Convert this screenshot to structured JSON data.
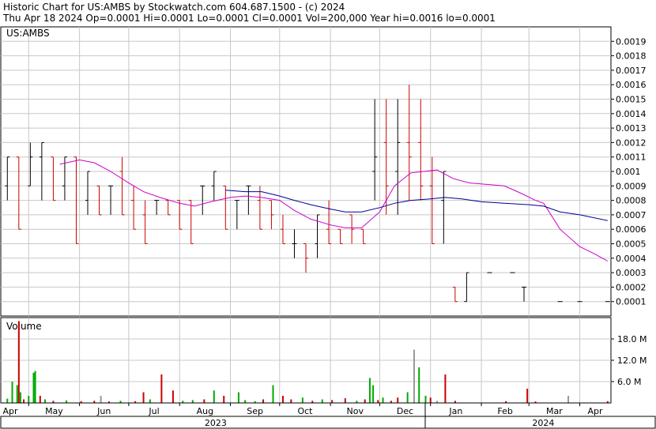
{
  "header": {
    "line1": "Historic Chart for US:AMBS by Stockwatch.com 604.687.1500 - (c) 2024",
    "line2": "Thu Apr 18 2024   Op=0.0001   Hi=0.0001   Lo=0.0001   Cl=0.0001   Vol=200,000   Year hi=0.0016   lo=0.0001"
  },
  "price_panel": {
    "label": "US:AMBS"
  },
  "volume_panel": {
    "label": "Volume"
  },
  "colors": {
    "up": "#000000",
    "down": "#cc0000",
    "ma_short": "#cc00cc",
    "ma_long": "#000099",
    "grid": "#c8c8c8",
    "vol_up": "#00aa00",
    "vol_down": "#cc0000",
    "vol_flat": "#999999"
  },
  "chart_data": [
    {
      "type": "line",
      "yticks": [
        "0.0001",
        "0.0002",
        "0.0003",
        "0.0004",
        "0.0005",
        "0.0006",
        "0.0007",
        "0.0008",
        "0.0009",
        "0.001",
        "0.0011",
        "0.0012",
        "0.0013",
        "0.0014",
        "0.0015",
        "0.0016",
        "0.0017",
        "0.0018",
        "0.0019"
      ],
      "ylim": [
        0,
        0.002
      ],
      "months": [
        "Apr",
        "May",
        "Jun",
        "Jul",
        "Aug",
        "Sep",
        "Oct",
        "Nov",
        "Dec",
        "Jan",
        "Feb",
        "Mar",
        "Apr"
      ],
      "years": [
        "2023",
        "2024"
      ],
      "ohlc": [
        [
          "2023-04-18",
          0.0009,
          0.0011,
          0.0008,
          0.0011
        ],
        [
          "2023-04-25",
          0.0011,
          0.0011,
          0.0006,
          0.0006
        ],
        [
          "2023-05-02",
          0.0009,
          0.0012,
          0.0009,
          0.0011
        ],
        [
          "2023-05-09",
          0.0011,
          0.0012,
          0.0008,
          0.0012
        ],
        [
          "2023-05-16",
          0.0011,
          0.0011,
          0.0008,
          0.0008
        ],
        [
          "2023-05-23",
          0.0009,
          0.0011,
          0.0008,
          0.0011
        ],
        [
          "2023-05-30",
          0.0011,
          0.0011,
          0.0005,
          0.0005
        ],
        [
          "2023-06-06",
          0.0008,
          0.001,
          0.0007,
          0.001
        ],
        [
          "2023-06-13",
          0.0009,
          0.0009,
          0.0007,
          0.0007
        ],
        [
          "2023-06-20",
          0.0009,
          0.0009,
          0.0007,
          0.0009
        ],
        [
          "2023-06-27",
          0.001,
          0.0011,
          0.0007,
          0.0007
        ],
        [
          "2023-07-04",
          0.0008,
          0.0009,
          0.0006,
          0.0006
        ],
        [
          "2023-07-11",
          0.0007,
          0.0008,
          0.0005,
          0.0005
        ],
        [
          "2023-07-18",
          0.0008,
          0.0008,
          0.0007,
          0.0008
        ],
        [
          "2023-07-25",
          0.0008,
          0.0008,
          0.0007,
          0.0007
        ],
        [
          "2023-08-01",
          0.0008,
          0.0008,
          0.0006,
          0.0006
        ],
        [
          "2023-08-08",
          0.0008,
          0.0008,
          0.0005,
          0.0005
        ],
        [
          "2023-08-15",
          0.0009,
          0.0009,
          0.0007,
          0.0009
        ],
        [
          "2023-08-22",
          0.0009,
          0.001,
          0.0008,
          0.001
        ],
        [
          "2023-08-29",
          0.0009,
          0.0009,
          0.0006,
          0.0006
        ],
        [
          "2023-09-05",
          0.0008,
          0.0008,
          0.0006,
          0.0008
        ],
        [
          "2023-09-12",
          0.0009,
          0.0009,
          0.0007,
          0.0009
        ],
        [
          "2023-09-19",
          0.0008,
          0.0009,
          0.0006,
          0.0006
        ],
        [
          "2023-09-26",
          0.0008,
          0.0008,
          0.0006,
          0.0007
        ],
        [
          "2023-10-03",
          0.0006,
          0.0007,
          0.0005,
          0.0005
        ],
        [
          "2023-10-10",
          0.0005,
          0.0006,
          0.0004,
          0.0005
        ],
        [
          "2023-10-17",
          0.0005,
          0.0005,
          0.0003,
          0.0004
        ],
        [
          "2023-10-24",
          0.0005,
          0.0007,
          0.0004,
          0.0007
        ],
        [
          "2023-10-31",
          0.0006,
          0.0008,
          0.0005,
          0.0005
        ],
        [
          "2023-11-07",
          0.0006,
          0.0006,
          0.0005,
          0.0005
        ],
        [
          "2023-11-14",
          0.0007,
          0.0007,
          0.0005,
          0.0006
        ],
        [
          "2023-11-21",
          0.0006,
          0.0006,
          0.0005,
          0.0005
        ],
        [
          "2023-11-28",
          0.001,
          0.0015,
          0.0008,
          0.0011
        ],
        [
          "2023-12-05",
          0.0012,
          0.0015,
          0.0007,
          0.0009
        ],
        [
          "2023-12-12",
          0.001,
          0.0015,
          0.0007,
          0.0012
        ],
        [
          "2023-12-19",
          0.0012,
          0.0016,
          0.0008,
          0.0011
        ],
        [
          "2023-12-26",
          0.0012,
          0.0015,
          0.0008,
          0.0009
        ],
        [
          "2024-01-02",
          0.0009,
          0.0011,
          0.0005,
          0.0005
        ],
        [
          "2024-01-09",
          0.0008,
          0.001,
          0.0005,
          0.001
        ],
        [
          "2024-01-16",
          0.0002,
          0.0002,
          0.0001,
          0.0001
        ],
        [
          "2024-01-23",
          0.0001,
          0.0003,
          0.0001,
          0.0003
        ],
        [
          "2024-02-06",
          0.0003,
          0.0003,
          0.0003,
          0.0003
        ],
        [
          "2024-02-20",
          0.0003,
          0.0003,
          0.0003,
          0.0003
        ],
        [
          "2024-02-27",
          0.0002,
          0.0002,
          0.0001,
          0.0002
        ],
        [
          "2024-03-20",
          0.0001,
          0.0001,
          0.0001,
          0.0001
        ],
        [
          "2024-04-01",
          0.0001,
          0.0001,
          0.0001,
          0.0001
        ],
        [
          "2024-04-18",
          0.0001,
          0.0001,
          0.0001,
          0.0001
        ]
      ],
      "series": [
        {
          "values": [
            [
              "2023-05-20",
              0.00105
            ],
            [
              "2023-06-01",
              0.00108
            ],
            [
              "2023-06-10",
              0.00106
            ],
            [
              "2023-06-20",
              0.001
            ],
            [
              "2023-07-01",
              0.00092
            ],
            [
              "2023-07-10",
              0.00086
            ],
            [
              "2023-07-20",
              0.00082
            ],
            [
              "2023-08-01",
              0.00078
            ],
            [
              "2023-08-10",
              0.00076
            ],
            [
              "2023-08-20",
              0.00079
            ],
            [
              "2023-09-01",
              0.00082
            ],
            [
              "2023-09-10",
              0.00083
            ],
            [
              "2023-09-20",
              0.00082
            ],
            [
              "2023-10-01",
              0.0008
            ],
            [
              "2023-10-10",
              0.00073
            ],
            [
              "2023-10-20",
              0.00067
            ],
            [
              "2023-11-01",
              0.00063
            ],
            [
              "2023-11-10",
              0.00061
            ],
            [
              "2023-11-20",
              0.00061
            ],
            [
              "2023-12-01",
              0.00072
            ],
            [
              "2023-12-10",
              0.0009
            ],
            [
              "2023-12-20",
              0.00099
            ],
            [
              "2023-12-28",
              0.001
            ],
            [
              "2024-01-05",
              0.00101
            ],
            [
              "2024-01-15",
              0.00095
            ],
            [
              "2024-01-25",
              0.00092
            ],
            [
              "2024-02-05",
              0.00091
            ],
            [
              "2024-02-15",
              0.0009
            ],
            [
              "2024-02-25",
              0.00085
            ],
            [
              "2024-03-05",
              0.0008
            ],
            [
              "2024-03-10",
              0.00078
            ],
            [
              "2024-03-20",
              0.0006
            ],
            [
              "2024-04-01",
              0.00048
            ],
            [
              "2024-04-10",
              0.00043
            ],
            [
              "2024-04-18",
              0.00038
            ]
          ]
        },
        {
          "values": [
            [
              "2023-08-29",
              0.00087
            ],
            [
              "2023-09-10",
              0.00086
            ],
            [
              "2023-09-20",
              0.00086
            ],
            [
              "2023-10-01",
              0.00083
            ],
            [
              "2023-10-10",
              0.0008
            ],
            [
              "2023-10-20",
              0.00077
            ],
            [
              "2023-11-01",
              0.00074
            ],
            [
              "2023-11-10",
              0.00072
            ],
            [
              "2023-11-20",
              0.00072
            ],
            [
              "2023-12-01",
              0.00075
            ],
            [
              "2023-12-10",
              0.00078
            ],
            [
              "2023-12-20",
              0.0008
            ],
            [
              "2024-01-01",
              0.00081
            ],
            [
              "2024-01-10",
              0.00082
            ],
            [
              "2024-01-20",
              0.00081
            ],
            [
              "2024-02-01",
              0.00079
            ],
            [
              "2024-02-15",
              0.00078
            ],
            [
              "2024-03-01",
              0.00077
            ],
            [
              "2024-03-10",
              0.00076
            ],
            [
              "2024-03-20",
              0.00072
            ],
            [
              "2024-04-01",
              0.0007
            ],
            [
              "2024-04-18",
              0.00066
            ]
          ]
        }
      ]
    },
    {
      "type": "bar",
      "yticks": [
        "6.0 M",
        "12.0 M",
        "18.0 M"
      ],
      "ylim": [
        0,
        24
      ],
      "volume": [
        [
          "2023-04-18",
          1.2,
          "up"
        ],
        [
          "2023-04-21",
          6.0,
          "up"
        ],
        [
          "2023-04-24",
          5.0,
          "up"
        ],
        [
          "2023-04-25",
          23.0,
          "down"
        ],
        [
          "2023-04-26",
          3.0,
          "up"
        ],
        [
          "2023-04-28",
          1.0,
          "down"
        ],
        [
          "2023-05-01",
          2.0,
          "up"
        ],
        [
          "2023-05-04",
          8.5,
          "up"
        ],
        [
          "2023-05-05",
          9.0,
          "up"
        ],
        [
          "2023-05-08",
          2.0,
          "down"
        ],
        [
          "2023-05-11",
          1.0,
          "up"
        ],
        [
          "2023-05-16",
          0.6,
          "down"
        ],
        [
          "2023-05-24",
          0.7,
          "up"
        ],
        [
          "2023-06-02",
          0.5,
          "down"
        ],
        [
          "2023-06-10",
          0.6,
          "down"
        ],
        [
          "2023-06-14",
          2.0,
          "flat"
        ],
        [
          "2023-06-19",
          0.4,
          "down"
        ],
        [
          "2023-06-26",
          0.6,
          "up"
        ],
        [
          "2023-07-05",
          0.5,
          "down"
        ],
        [
          "2023-07-10",
          3.0,
          "down"
        ],
        [
          "2023-07-14",
          1.0,
          "up"
        ],
        [
          "2023-07-21",
          8.0,
          "down"
        ],
        [
          "2023-07-28",
          3.5,
          "down"
        ],
        [
          "2023-08-03",
          0.6,
          "up"
        ],
        [
          "2023-08-09",
          0.8,
          "up"
        ],
        [
          "2023-08-16",
          1.0,
          "down"
        ],
        [
          "2023-08-22",
          3.5,
          "up"
        ],
        [
          "2023-08-28",
          2.0,
          "down"
        ],
        [
          "2023-09-06",
          3.0,
          "up"
        ],
        [
          "2023-09-10",
          0.8,
          "up"
        ],
        [
          "2023-09-16",
          0.5,
          "up"
        ],
        [
          "2023-09-21",
          1.0,
          "down"
        ],
        [
          "2023-09-27",
          5.0,
          "up"
        ],
        [
          "2023-10-03",
          2.0,
          "down"
        ],
        [
          "2023-10-08",
          1.0,
          "down"
        ],
        [
          "2023-10-15",
          1.5,
          "up"
        ],
        [
          "2023-10-21",
          0.6,
          "down"
        ],
        [
          "2023-10-27",
          1.0,
          "up"
        ],
        [
          "2023-11-02",
          0.8,
          "down"
        ],
        [
          "2023-11-10",
          1.3,
          "down"
        ],
        [
          "2023-11-17",
          0.6,
          "up"
        ],
        [
          "2023-11-22",
          1.0,
          "down"
        ],
        [
          "2023-11-25",
          7.0,
          "up"
        ],
        [
          "2023-11-27",
          5.0,
          "up"
        ],
        [
          "2023-11-30",
          0.8,
          "down"
        ],
        [
          "2023-12-03",
          1.5,
          "up"
        ],
        [
          "2023-12-08",
          0.6,
          "down"
        ],
        [
          "2023-12-12",
          1.5,
          "down"
        ],
        [
          "2023-12-18",
          3.0,
          "up"
        ],
        [
          "2023-12-22",
          15.0,
          "flat"
        ],
        [
          "2023-12-25",
          10.0,
          "up"
        ],
        [
          "2023-12-29",
          2.0,
          "up"
        ],
        [
          "2024-01-01",
          1.5,
          "down"
        ],
        [
          "2024-01-05",
          0.6,
          "flat"
        ],
        [
          "2024-01-10",
          8.0,
          "down"
        ],
        [
          "2024-01-16",
          0.6,
          "down"
        ],
        [
          "2024-02-16",
          0.5,
          "down"
        ],
        [
          "2024-02-29",
          4.0,
          "down"
        ],
        [
          "2024-03-05",
          0.4,
          "down"
        ],
        [
          "2024-03-25",
          2.0,
          "flat"
        ],
        [
          "2024-04-18",
          0.5,
          "down"
        ]
      ]
    }
  ]
}
